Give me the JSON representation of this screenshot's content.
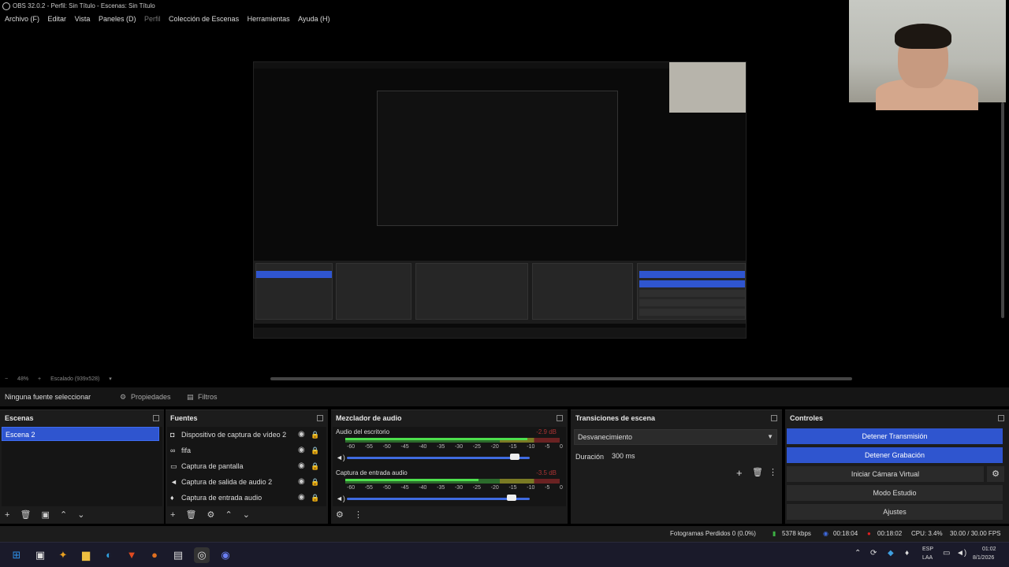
{
  "window": {
    "title": "OBS 32.0.2 - Perfil: Sin Título - Escenas: Sin Título"
  },
  "menu": {
    "items": [
      "Archivo (F)",
      "Editar",
      "Vista",
      "Paneles (D)",
      "Perfil",
      "Colección de Escenas",
      "Herramientas",
      "Ayuda (H)"
    ]
  },
  "preview": {
    "zoom": "48%",
    "scale_label": "Escalado (939x528)"
  },
  "context": {
    "no_source": "Ninguna fuente seleccionar",
    "properties": "Propiedades",
    "filters": "Filtros"
  },
  "scenes": {
    "title": "Escenas",
    "selected": "Escena 2"
  },
  "sources": {
    "title": "Fuentes",
    "items": [
      {
        "label": "Dispositivo de captura de vídeo 2",
        "icon": "camera-icon"
      },
      {
        "label": "fifa",
        "icon": "link-icon"
      },
      {
        "label": "Captura de pantalla",
        "icon": "monitor-icon"
      },
      {
        "label": "Captura de salida de audio 2",
        "icon": "speaker-icon"
      },
      {
        "label": "Captura de entrada audio",
        "icon": "microphone-icon"
      }
    ]
  },
  "mixer": {
    "title": "Mezclador de audio",
    "ticks": [
      "-60",
      "-55",
      "-50",
      "-45",
      "-40",
      "-35",
      "-30",
      "-25",
      "-20",
      "-15",
      "-10",
      "-5",
      "0"
    ],
    "channels": [
      {
        "name": "Audio del escritorio",
        "db": "-2.9 dB",
        "level": 0.85,
        "volume": 0.92
      },
      {
        "name": "Captura de entrada audio",
        "db": "-3.5 dB",
        "level": 0.62,
        "volume": 0.9
      }
    ]
  },
  "transitions": {
    "title": "Transiciones de escena",
    "selected": "Desvanecimiento",
    "duration_label": "Duración",
    "duration_value": "300 ms"
  },
  "controls": {
    "title": "Controles",
    "stop_stream": "Detener Transmisión",
    "stop_record": "Detener Grabación",
    "virtual_cam": "Iniciar Cámara Virtual",
    "studio_mode": "Modo Estudio",
    "settings": "Ajustes"
  },
  "status": {
    "dropped": "Fotogramas Perdidos 0 (0.0%)",
    "bitrate": "5378 kbps",
    "stream_time": "00:18:04",
    "record_time": "00:18:02",
    "cpu": "CPU: 3.4%",
    "fps": "30.00 / 30.00 FPS"
  },
  "taskbar": {
    "lang_top": "ESP",
    "lang_bottom": "LAA",
    "time": "01:02",
    "date": "8/1/2026"
  },
  "colors": {
    "accent": "#2f55cf",
    "panel": "#1c1c1c",
    "record": "#e02020",
    "stream_ok": "#3cb043"
  }
}
